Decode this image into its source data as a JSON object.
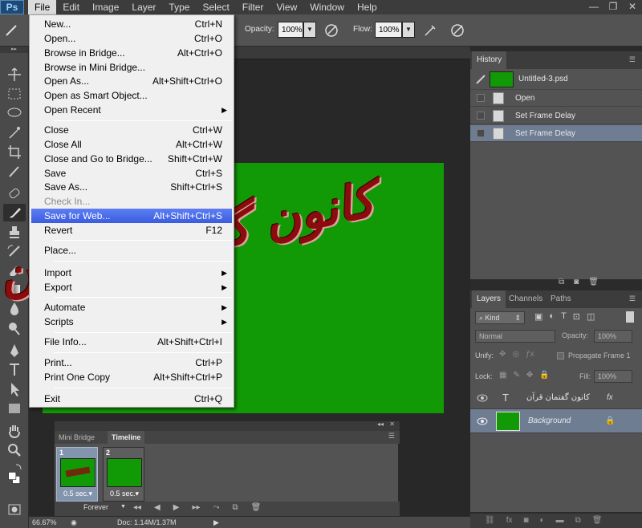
{
  "app": {
    "logo": "Ps"
  },
  "menubar": [
    "File",
    "Edit",
    "Image",
    "Layer",
    "Type",
    "Select",
    "Filter",
    "View",
    "Window",
    "Help"
  ],
  "options": {
    "opacity_label": "Opacity:",
    "opacity_value": "100%",
    "flow_label": "Flow:",
    "flow_value": "100%"
  },
  "file_menu": {
    "items": [
      {
        "label": "New...",
        "shortcut": "Ctrl+N"
      },
      {
        "label": "Open...",
        "shortcut": "Ctrl+O"
      },
      {
        "label": "Browse in Bridge...",
        "shortcut": "Alt+Ctrl+O"
      },
      {
        "label": "Browse in Mini Bridge...",
        "shortcut": ""
      },
      {
        "label": "Open As...",
        "shortcut": "Alt+Shift+Ctrl+O"
      },
      {
        "label": "Open as Smart Object...",
        "shortcut": ""
      },
      {
        "label": "Open Recent",
        "shortcut": ""
      },
      {
        "label": "Close",
        "shortcut": "Ctrl+W"
      },
      {
        "label": "Close All",
        "shortcut": "Alt+Ctrl+W"
      },
      {
        "label": "Close and Go to Bridge...",
        "shortcut": "Shift+Ctrl+W"
      },
      {
        "label": "Save",
        "shortcut": "Ctrl+S"
      },
      {
        "label": "Save As...",
        "shortcut": "Shift+Ctrl+S"
      },
      {
        "label": "Check In...",
        "shortcut": ""
      },
      {
        "label": "Save for Web...",
        "shortcut": "Alt+Shift+Ctrl+S"
      },
      {
        "label": "Revert",
        "shortcut": "F12"
      },
      {
        "label": "Place...",
        "shortcut": ""
      },
      {
        "label": "Import",
        "shortcut": ""
      },
      {
        "label": "Export",
        "shortcut": ""
      },
      {
        "label": "Automate",
        "shortcut": ""
      },
      {
        "label": "Scripts",
        "shortcut": ""
      },
      {
        "label": "File Info...",
        "shortcut": "Alt+Shift+Ctrl+I"
      },
      {
        "label": "Print...",
        "shortcut": "Ctrl+P"
      },
      {
        "label": "Print One Copy",
        "shortcut": "Alt+Shift+Ctrl+P"
      },
      {
        "label": "Exit",
        "shortcut": "Ctrl+Q"
      }
    ]
  },
  "history": {
    "tab": "History",
    "snapshot": "Untitled-3.psd",
    "steps": [
      "Open",
      "Set Frame Delay",
      "Set Frame Delay"
    ]
  },
  "layers_panel": {
    "tabs": [
      "Layers",
      "Channels",
      "Paths"
    ],
    "kind": "Kind",
    "blend_mode": "Normal",
    "opacity_label": "Opacity:",
    "opacity_value": "100%",
    "unify_label": "Unify:",
    "propagate": "Propagate Frame 1",
    "lock_label": "Lock:",
    "fill_label": "Fill:",
    "fill_value": "100%",
    "layers": [
      {
        "name": "کانون گفتمان قرآن",
        "type": "T"
      },
      {
        "name": "Background"
      }
    ]
  },
  "canvas_text": "کانون گفتمان قرآن",
  "timeline": {
    "tabs": [
      "Mini Bridge",
      "Timeline"
    ],
    "frames": [
      {
        "num": "1",
        "delay": "0.5 sec.▾"
      },
      {
        "num": "2",
        "delay": "0.5 sec.▾"
      }
    ],
    "loop": "Forever"
  },
  "status": {
    "zoom": "66.67%",
    "doc": "Doc: 1.14M/1.37M"
  },
  "colors": {
    "canvas_green": "#119a05",
    "highlight": "#3a5ce0",
    "selected_row": "#6e7d92"
  }
}
